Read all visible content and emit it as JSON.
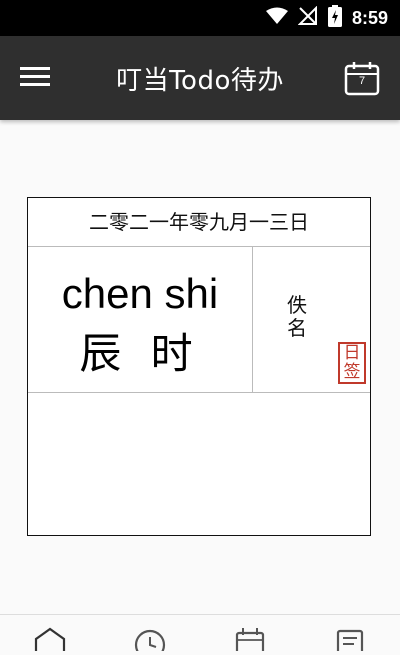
{
  "status_bar": {
    "time": "8:59",
    "icons": [
      "wifi-icon",
      "no-signal-icon",
      "battery-charging-icon"
    ]
  },
  "app_bar": {
    "title": "叮当Todo待办",
    "calendar_day": "7",
    "icons": [
      "menu-icon",
      "calendar-icon"
    ]
  },
  "card": {
    "date": "二零二一年零九月一三日",
    "time_pinyin": "chen shi",
    "time_hanzi": "辰 时",
    "author_chars": [
      "佚",
      "名"
    ],
    "seal_chars": [
      "日",
      "签"
    ],
    "seal_color": "#c0392b"
  },
  "bottom_nav": {
    "items": [
      "home-icon",
      "clock-icon",
      "calendar-icon",
      "notes-icon"
    ]
  }
}
